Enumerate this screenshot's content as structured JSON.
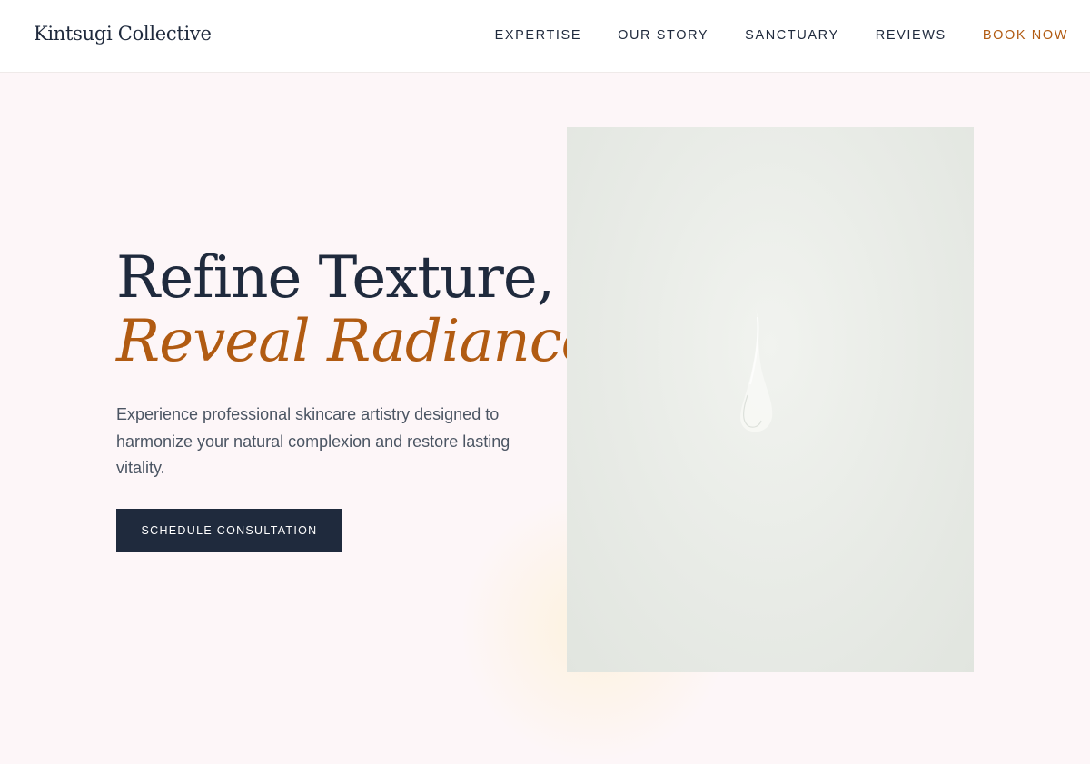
{
  "header": {
    "brand": "Kintsugi Collective",
    "nav": [
      {
        "label": "EXPERTISE"
      },
      {
        "label": "OUR STORY"
      },
      {
        "label": "SANCTUARY"
      },
      {
        "label": "REVIEWS"
      },
      {
        "label": "BOOK NOW"
      }
    ]
  },
  "hero": {
    "headline_line1": "Refine Texture,",
    "headline_line2": "Reveal Radiance.",
    "lead": "Experience professional skincare artistry designed to harmonize your natural complexion and restore lasting vitality.",
    "cta_label": "SCHEDULE CONSULTATION"
  },
  "colors": {
    "ink": "#1f2a3d",
    "accent": "#b15b12",
    "background": "#fdf6f8",
    "body_text": "#4b5563"
  }
}
